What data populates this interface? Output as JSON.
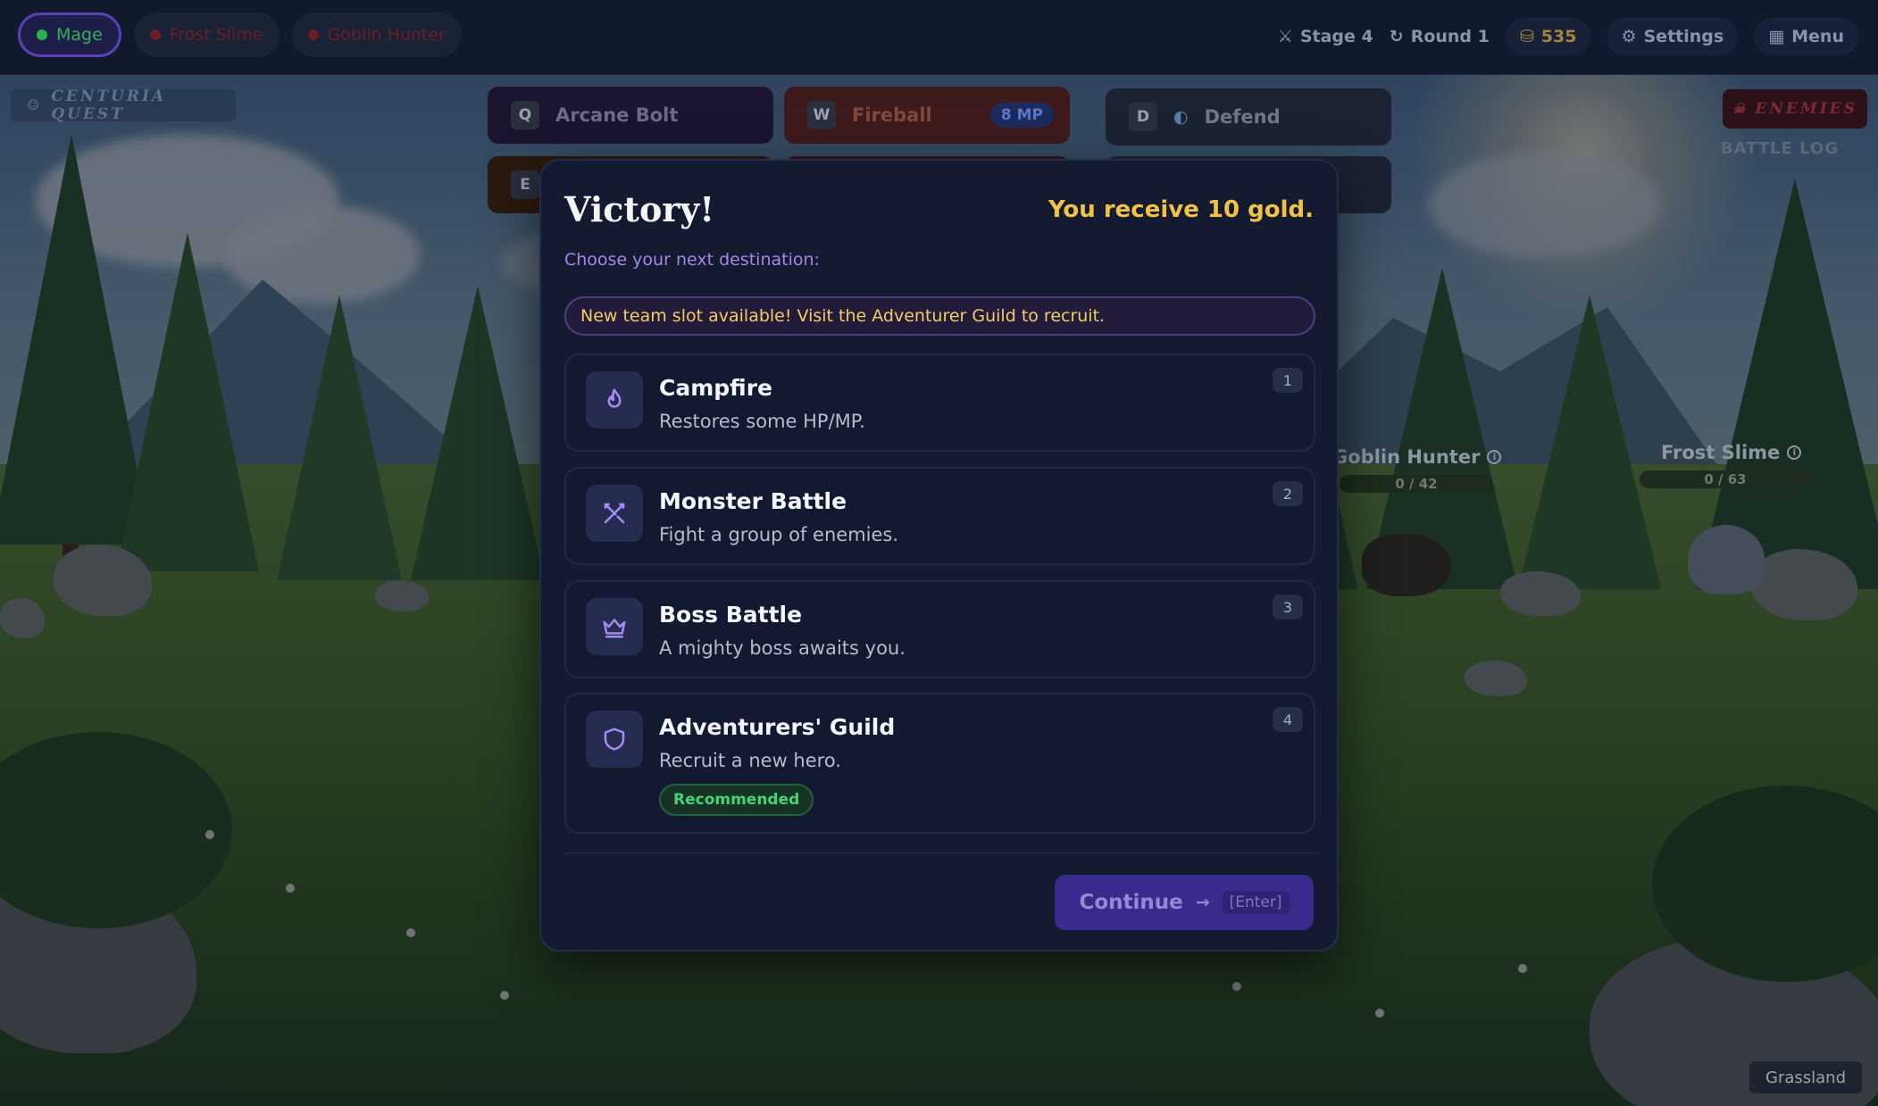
{
  "party": [
    {
      "name": "Mage",
      "active": true
    },
    {
      "name": "Frost Slime",
      "active": false
    },
    {
      "name": "Goblin Hunter",
      "active": false
    }
  ],
  "hud": {
    "stage": "Stage 4",
    "round": "Round 1",
    "gold": "535",
    "settings": "Settings",
    "menu": "Menu"
  },
  "quest_tag": "CENTURIA QUEST",
  "enemies_tag": "ENEMIES",
  "battle_log_tag": "BATTLE LOG",
  "skills": [
    {
      "key": "Q",
      "name": "Arcane Bolt",
      "cost": ""
    },
    {
      "key": "W",
      "name": "Fireball",
      "cost": "8 MP"
    },
    {
      "key": "D",
      "name": "Defend",
      "cost": ""
    },
    {
      "key": "E",
      "name": "",
      "cost": ""
    }
  ],
  "enemies": [
    {
      "name": "Goblin Hunter",
      "hp": "0 / 42"
    },
    {
      "name": "Frost Slime",
      "hp": "0 / 63"
    }
  ],
  "biome": "Grassland",
  "modal": {
    "title": "Victory!",
    "reward": "You receive 10 gold.",
    "subtitle": "Choose your next destination:",
    "notice": "New team slot available! Visit the Adventurer Guild to recruit.",
    "destinations": [
      {
        "num": "1",
        "title": "Campfire",
        "desc": "Restores some HP/MP.",
        "icon": "flame-icon",
        "badge": ""
      },
      {
        "num": "2",
        "title": "Monster Battle",
        "desc": "Fight a group of enemies.",
        "icon": "crossed-swords-icon",
        "badge": ""
      },
      {
        "num": "3",
        "title": "Boss Battle",
        "desc": "A mighty boss awaits you.",
        "icon": "crown-icon",
        "badge": ""
      },
      {
        "num": "4",
        "title": "Adventurers' Guild",
        "desc": "Recruit a new hero.",
        "icon": "shield-icon",
        "badge": "Recommended"
      }
    ],
    "continue_label": "Continue",
    "continue_key": "[Enter]"
  },
  "colors": {
    "accent": "#5b3fb5",
    "gold": "#f0c246",
    "recommended": "#48d27c",
    "modal_bg": "#141b31"
  }
}
